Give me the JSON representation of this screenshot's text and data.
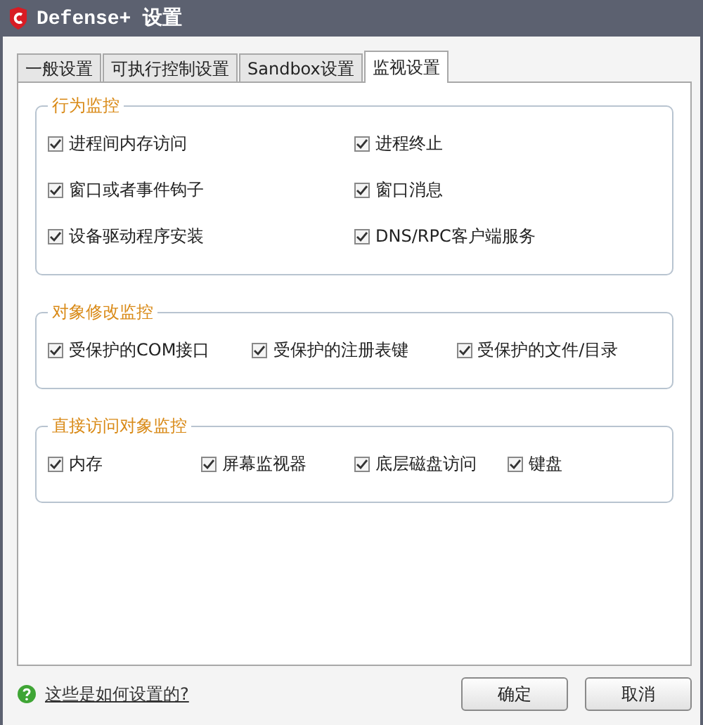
{
  "window": {
    "title": "Defense+ 设置"
  },
  "tabs": [
    {
      "label": "一般设置",
      "selected": false
    },
    {
      "label": "可执行控制设置",
      "selected": false
    },
    {
      "label": "Sandbox设置",
      "selected": false
    },
    {
      "label": "监视设置",
      "selected": true
    }
  ],
  "groups": [
    {
      "title": "行为监控",
      "rows": [
        [
          {
            "label": "进程间内存访问",
            "checked": true
          },
          {
            "label": "进程终止",
            "checked": true
          }
        ],
        [
          {
            "label": "窗口或者事件钩子",
            "checked": true
          },
          {
            "label": "窗口消息",
            "checked": true
          }
        ],
        [
          {
            "label": "设备驱动程序安装",
            "checked": true
          },
          {
            "label": "DNS/RPC客户端服务",
            "checked": true
          }
        ]
      ]
    },
    {
      "title": "对象修改监控",
      "rows": [
        [
          {
            "label": "受保护的COM接口",
            "checked": true
          },
          {
            "label": "受保护的注册表键",
            "checked": true
          },
          {
            "label": "受保护的文件/目录",
            "checked": true
          }
        ]
      ]
    },
    {
      "title": "直接访问对象监控",
      "rows": [
        [
          {
            "label": "内存",
            "checked": true
          },
          {
            "label": "屏幕监视器",
            "checked": true
          },
          {
            "label": "底层磁盘访问",
            "checked": true
          },
          {
            "label": "键盘",
            "checked": true
          }
        ]
      ]
    }
  ],
  "help_link": "这些是如何设置的?",
  "buttons": [
    "确定",
    "取消"
  ]
}
